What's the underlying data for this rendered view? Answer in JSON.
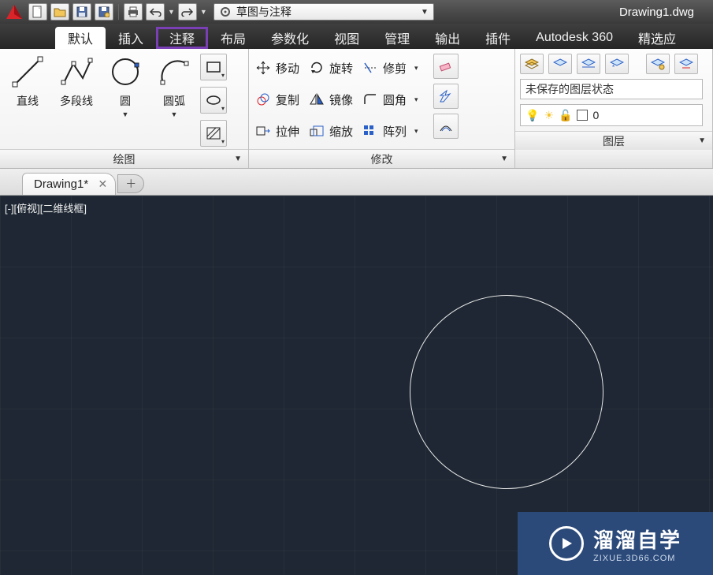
{
  "app": {
    "document_title": "Drawing1.dwg",
    "workspace": "草图与注释"
  },
  "qat": {
    "items": [
      {
        "name": "new-file-icon",
        "glyph": "new"
      },
      {
        "name": "open-file-icon",
        "glyph": "open"
      },
      {
        "name": "save-icon",
        "glyph": "save"
      },
      {
        "name": "saveas-icon",
        "glyph": "saveas"
      },
      {
        "name": "print-icon",
        "glyph": "print"
      },
      {
        "name": "undo-icon",
        "glyph": "undo"
      },
      {
        "name": "redo-icon",
        "glyph": "redo"
      }
    ]
  },
  "menu": {
    "tabs": [
      {
        "label": "默认",
        "state": "active"
      },
      {
        "label": "插入",
        "state": ""
      },
      {
        "label": "注释",
        "state": "highlight"
      },
      {
        "label": "布局",
        "state": ""
      },
      {
        "label": "参数化",
        "state": ""
      },
      {
        "label": "视图",
        "state": ""
      },
      {
        "label": "管理",
        "state": ""
      },
      {
        "label": "输出",
        "state": ""
      },
      {
        "label": "插件",
        "state": ""
      },
      {
        "label": "Autodesk 360",
        "state": ""
      },
      {
        "label": "精选应",
        "state": ""
      }
    ]
  },
  "ribbon": {
    "draw": {
      "title": "绘图",
      "big": [
        {
          "label": "直线",
          "name": "line-button"
        },
        {
          "label": "多段线",
          "name": "polyline-button"
        },
        {
          "label": "圆",
          "name": "circle-button"
        },
        {
          "label": "圆弧",
          "name": "arc-button"
        }
      ]
    },
    "modify": {
      "title": "修改",
      "rows": [
        [
          {
            "label": "移动",
            "name": "move-button"
          },
          {
            "label": "旋转",
            "name": "rotate-button"
          },
          {
            "label": "修剪",
            "name": "trim-button"
          }
        ],
        [
          {
            "label": "复制",
            "name": "copy-button"
          },
          {
            "label": "镜像",
            "name": "mirror-button"
          },
          {
            "label": "圆角",
            "name": "fillet-button"
          }
        ],
        [
          {
            "label": "拉伸",
            "name": "stretch-button"
          },
          {
            "label": "缩放",
            "name": "scale-button"
          },
          {
            "label": "阵列",
            "name": "array-button"
          }
        ]
      ]
    },
    "layer": {
      "title": "图层",
      "state_text": "未保存的图层状态",
      "current_layer": "0"
    }
  },
  "doctabs": {
    "tab1": "Drawing1*"
  },
  "canvas": {
    "view_label": "[-][俯视][二维线框]"
  },
  "watermark": {
    "big": "溜溜自学",
    "small": "ZIXUE.3D66.COM"
  }
}
